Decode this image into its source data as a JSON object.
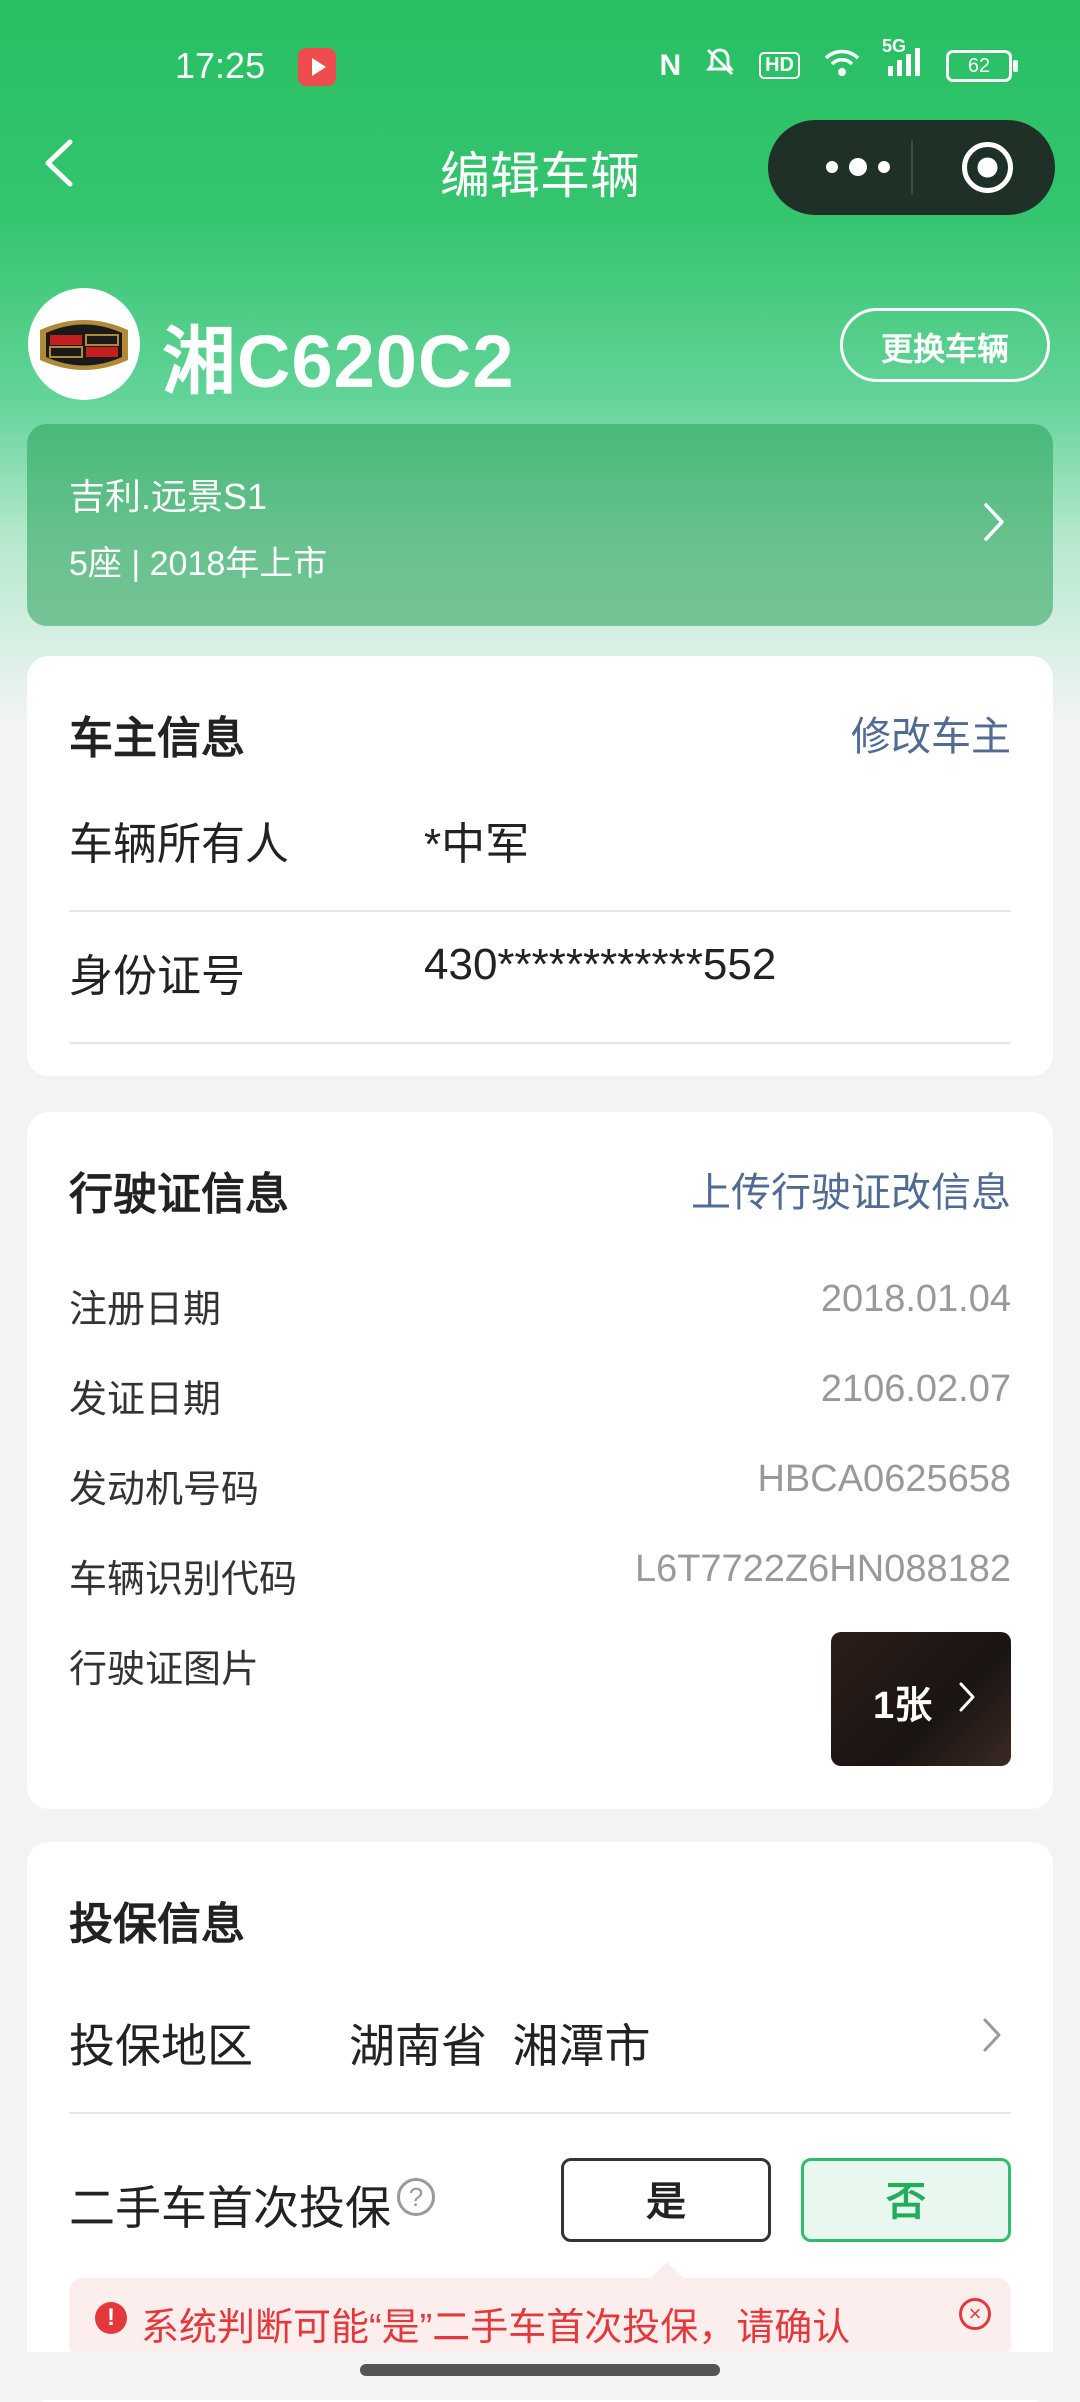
{
  "status_bar": {
    "time": "17:25",
    "battery": "62",
    "signal": "5G",
    "hd": "HD",
    "nfc": "N"
  },
  "nav": {
    "title": "编辑车辆"
  },
  "vehicle": {
    "plate": "湘C620C2",
    "change_label": "更换车辆",
    "model": "吉利.远景S1",
    "spec": "5座 | 2018年上市"
  },
  "owner": {
    "title": "车主信息",
    "edit_label": "修改车主",
    "rows": [
      {
        "label": "车辆所有人",
        "value": "*中军"
      },
      {
        "label": "身份证号",
        "value": "430************552"
      }
    ]
  },
  "license": {
    "title": "行驶证信息",
    "upload_label": "上传行驶证改信息",
    "rows": [
      {
        "label": "注册日期",
        "value": "2018.01.04"
      },
      {
        "label": "发证日期",
        "value": "2106.02.07"
      },
      {
        "label": "发动机号码",
        "value": "HBCA0625658"
      },
      {
        "label": "车辆识别代码",
        "value": "L6T7722Z6HN088182"
      }
    ],
    "photo_label": "行驶证图片",
    "photo_count": "1张"
  },
  "insurance": {
    "title": "投保信息",
    "region_label": "投保地区",
    "region_value": "湖南省  湘潭市",
    "first_label": "二手车首次投保",
    "help_symbol": "?",
    "yes_label": "是",
    "no_label": "否",
    "warning": "系统判断可能“是”二手车首次投保，请确认",
    "warning_icon": "!",
    "close_symbol": "×"
  },
  "colors": {
    "brand": "#27bf62",
    "link": "#506b94",
    "warning": "#e4393c"
  }
}
